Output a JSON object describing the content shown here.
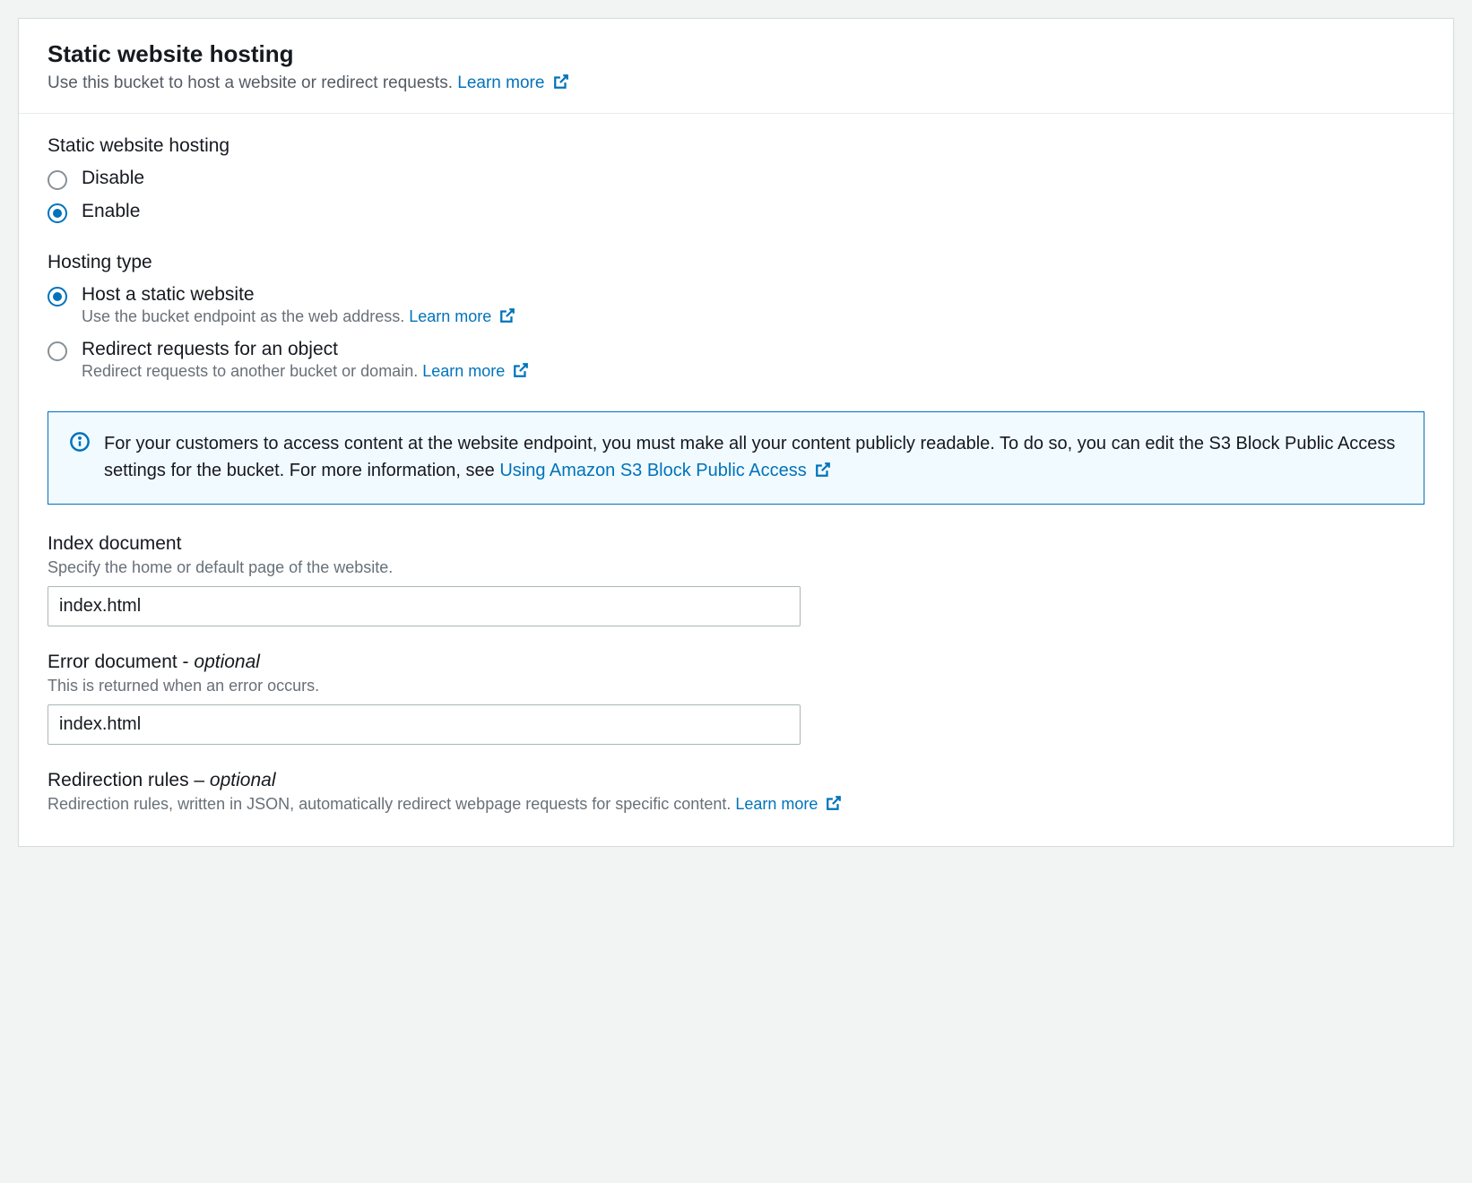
{
  "header": {
    "title": "Static website hosting",
    "description": "Use this bucket to host a website or redirect requests.",
    "learn_more": "Learn more"
  },
  "hosting_section": {
    "label": "Static website hosting",
    "options": {
      "disable": "Disable",
      "enable": "Enable"
    }
  },
  "hosting_type": {
    "label": "Hosting type",
    "static": {
      "label": "Host a static website",
      "desc": "Use the bucket endpoint as the web address.",
      "learn_more": "Learn more"
    },
    "redirect": {
      "label": "Redirect requests for an object",
      "desc": "Redirect requests to another bucket or domain.",
      "learn_more": "Learn more"
    }
  },
  "info": {
    "text": "For your customers to access content at the website endpoint, you must make all your content publicly readable. To do so, you can edit the S3 Block Public Access settings for the bucket. For more information, see ",
    "link": "Using Amazon S3 Block Public Access"
  },
  "index_doc": {
    "label": "Index document",
    "hint": "Specify the home or default page of the website.",
    "value": "index.html"
  },
  "error_doc": {
    "label": "Error document - ",
    "optional": "optional",
    "hint": "This is returned when an error occurs.",
    "value": "index.html"
  },
  "redirection": {
    "label": "Redirection rules – ",
    "optional": "optional",
    "hint": "Redirection rules, written in JSON, automatically redirect webpage requests for specific content.",
    "learn_more": "Learn more"
  }
}
